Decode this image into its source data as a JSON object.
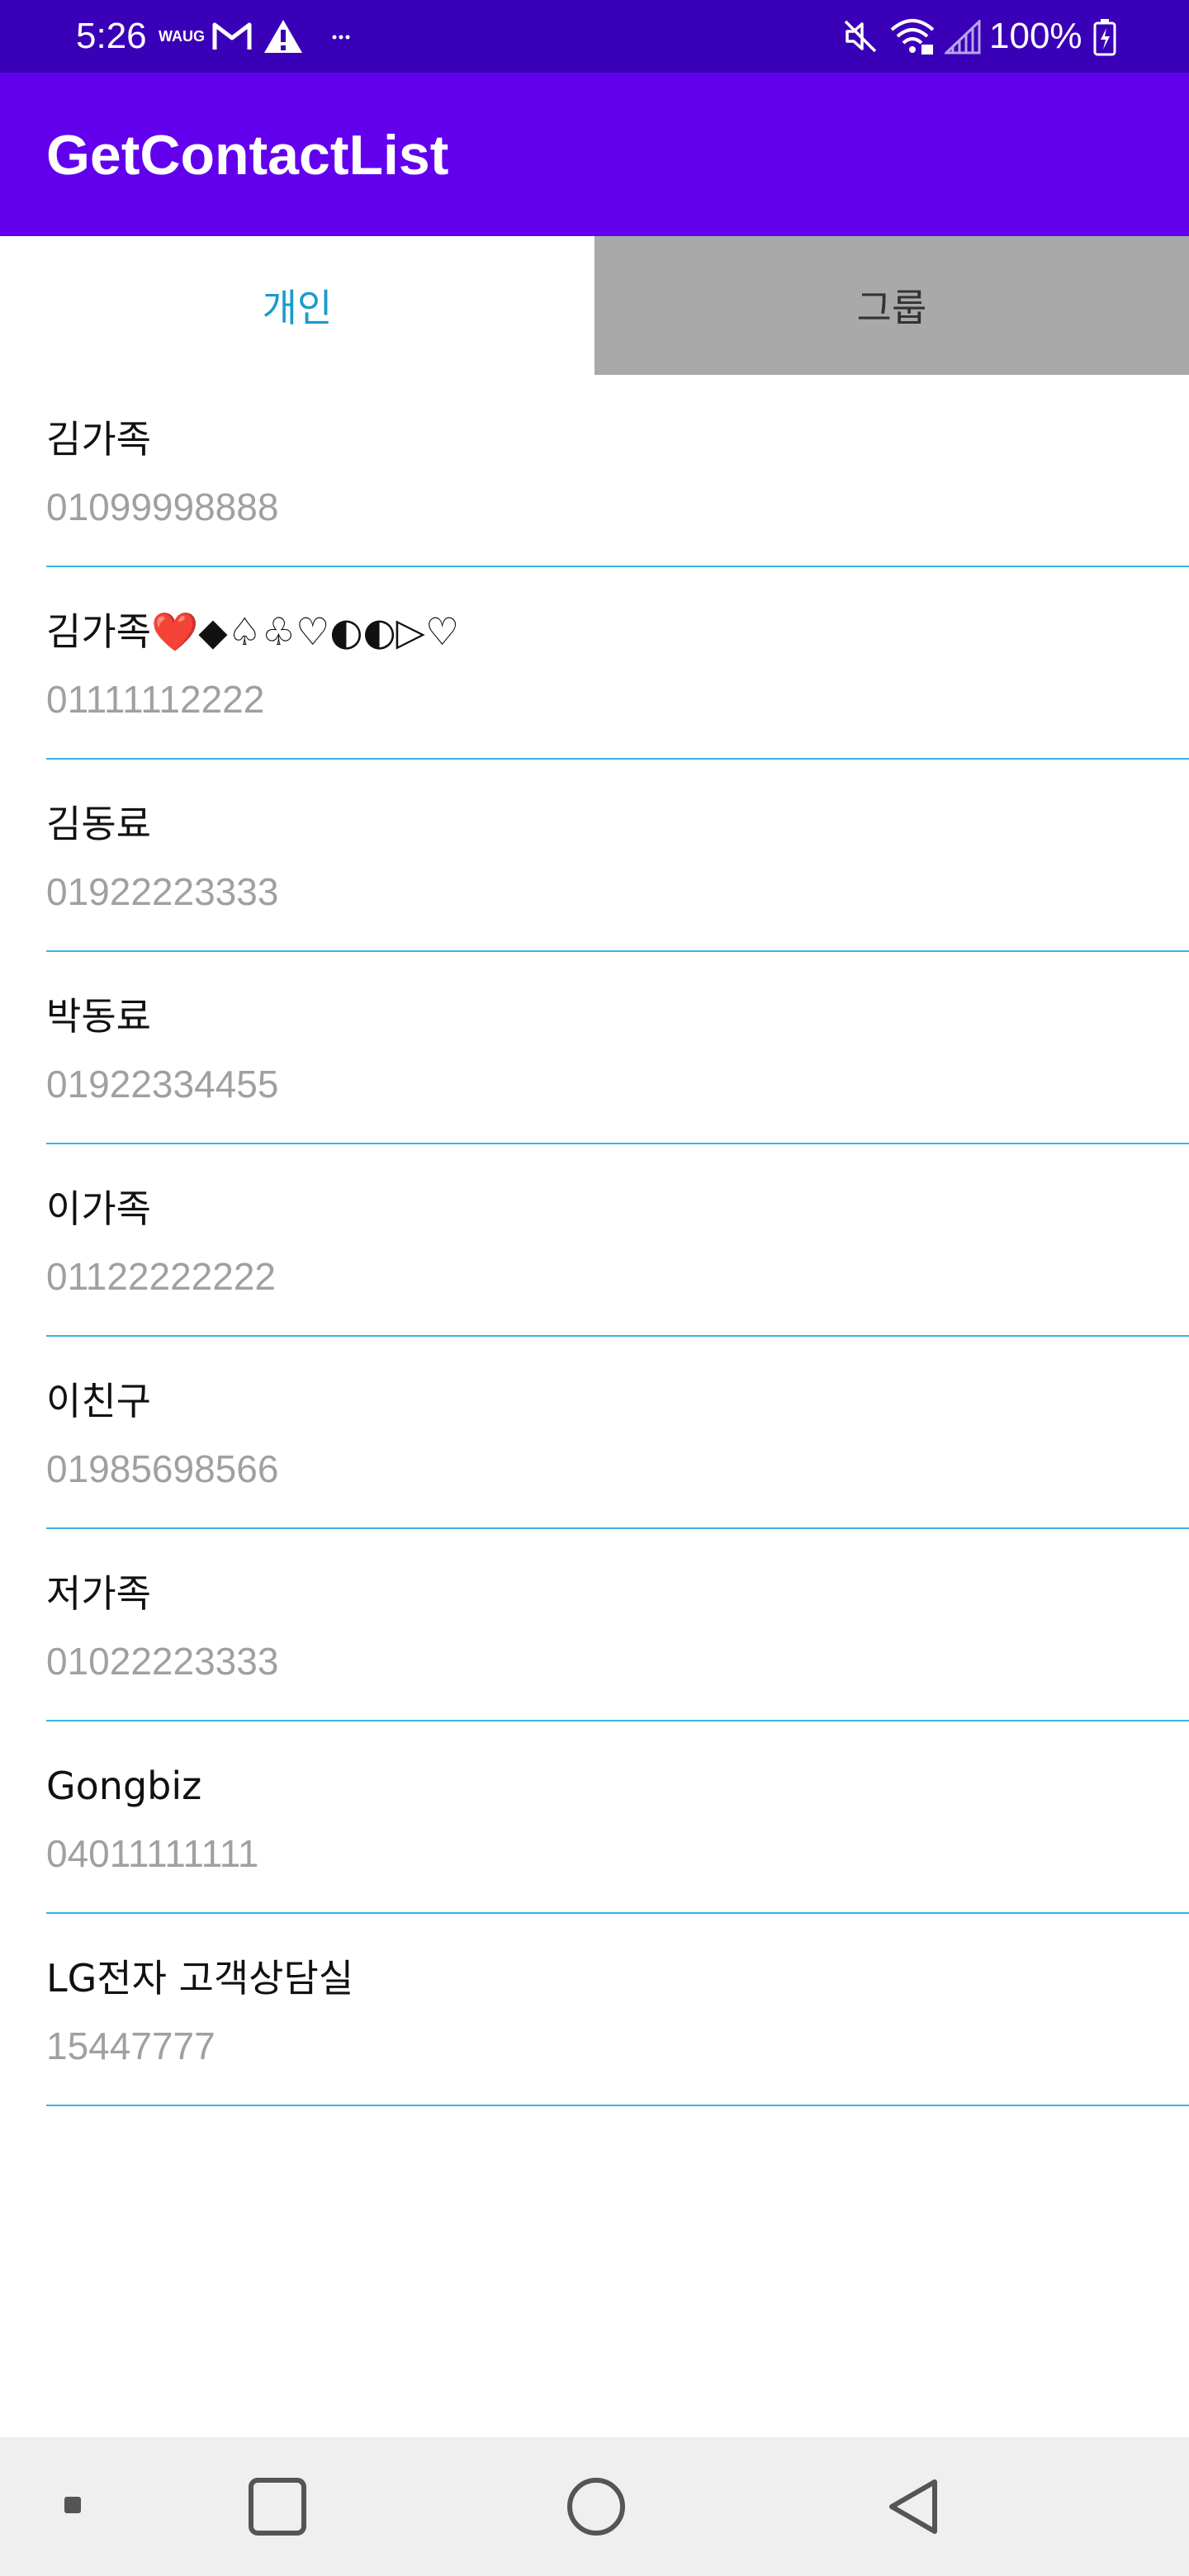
{
  "status_bar": {
    "time": "5:26",
    "battery": "100%",
    "icons": [
      "waug-icon",
      "gmail-icon",
      "alert-icon",
      "more-notifications-icon",
      "mute-icon",
      "wifi-icon",
      "signal-icon",
      "battery-icon"
    ],
    "background": "#3a00b7"
  },
  "app_bar": {
    "title": "GetContactList",
    "background": "#6200ee"
  },
  "tabs": [
    {
      "label": "개인",
      "selected": true
    },
    {
      "label": "그룹",
      "selected": false
    }
  ],
  "contacts": [
    {
      "name": "김가족",
      "phone": "01099998888"
    },
    {
      "name": "김가족❤️◆♤♧♡◐◐▷♡",
      "phone": "01111112222"
    },
    {
      "name": "김동료",
      "phone": "01922223333"
    },
    {
      "name": "박동료",
      "phone": "01922334455"
    },
    {
      "name": "이가족",
      "phone": "01122222222"
    },
    {
      "name": "이친구",
      "phone": "01985698566"
    },
    {
      "name": "저가족",
      "phone": "01022223333"
    },
    {
      "name": "Gongbiz",
      "phone": "04011111111"
    },
    {
      "name": "LG전자 고객상담실",
      "phone": "15447777"
    }
  ],
  "nav_bar": {
    "buttons": [
      "notification-dot-icon",
      "recents-icon",
      "home-icon",
      "back-icon"
    ]
  },
  "colors": {
    "accent": "#1a9bcc",
    "divider": "#35b4e6",
    "inactive_tab": "#a9a9a9"
  }
}
